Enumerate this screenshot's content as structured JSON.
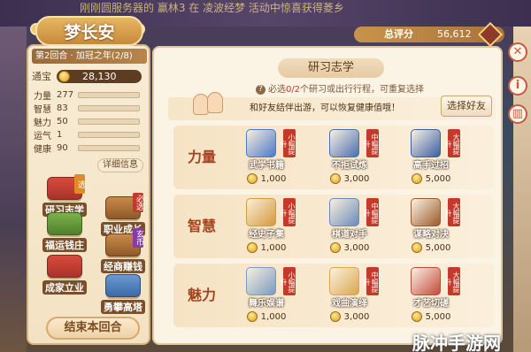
{
  "header": {
    "ticker": "刚刚圆服务器的 赢林3 在 凌波经梦 活动中惊喜获得菱乡",
    "title": "梦长安",
    "score_label": "总评分",
    "score_value": "56,612"
  },
  "left_panel": {
    "round_info": "第2回合 · 加冠之年(2/8)",
    "coins_label": "通宝",
    "coins_value": "28,130",
    "stats": [
      {
        "name": "力量",
        "value": "277",
        "fraction": 0.3
      },
      {
        "name": "智慧",
        "value": "83",
        "fraction": 0.1
      },
      {
        "name": "魅力",
        "value": "50",
        "fraction": 0.06
      },
      {
        "name": "运气",
        "value": "1",
        "fraction": 0.02
      },
      {
        "name": "健康",
        "value": "90",
        "fraction": 0.4
      }
    ],
    "detail_label": "详细信息",
    "locations": [
      {
        "label": "研习志学",
        "tag": "选"
      },
      {
        "label": "职业成长",
        "tag": "必选"
      },
      {
        "label": "福运钱庄",
        "tag": ""
      },
      {
        "label": "经商赚钱",
        "tag": "玄币"
      },
      {
        "label": "成家立业",
        "tag": ""
      },
      {
        "label": "勇攀高塔",
        "tag": ""
      }
    ],
    "end_label": "结束本回合"
  },
  "main": {
    "section_title": "研习志学",
    "hint_prefix": "必选",
    "hint_count": "0/2",
    "hint_rest": "个研习或出行行程，可重复选择",
    "friend_text": "和好友结伴出游，可以恢复健康值哦！",
    "choose_friend_label": "选择好友",
    "rows": [
      {
        "name": "力量",
        "activities": [
          {
            "name": "武学书籍",
            "tag": "小幅提升",
            "cost": "1,000",
            "color": "#4a7ac9"
          },
          {
            "name": "不拒试炼",
            "tag": "中幅提升",
            "cost": "3,000",
            "color": "#4a6fb0"
          },
          {
            "name": "高手过招",
            "tag": "大幅提升",
            "cost": "5,000",
            "color": "#3a5fa0"
          }
        ]
      },
      {
        "name": "智慧",
        "activities": [
          {
            "name": "经史子集",
            "tag": "小幅提升",
            "cost": "1,000",
            "color": "#d39a3a"
          },
          {
            "name": "棋道对手",
            "tag": "中幅提升",
            "cost": "3,000",
            "color": "#6a8ab8"
          },
          {
            "name": "谋略对决",
            "tag": "大幅提升",
            "cost": "5,000",
            "color": "#9a5a2a"
          }
        ]
      },
      {
        "name": "魅力",
        "activities": [
          {
            "name": "舞乐娱谱",
            "tag": "小幅提升",
            "cost": "1,000",
            "color": "#7a9ac2"
          },
          {
            "name": "戏曲演绎",
            "tag": "中幅提升",
            "cost": "3,000",
            "color": "#d9a84a"
          },
          {
            "name": "才艺切磋",
            "tag": "大幅提升",
            "cost": "5,000",
            "color": "#c24a3a"
          }
        ]
      }
    ]
  },
  "side_buttons": [
    {
      "icon": "close-icon",
      "glyph": "✕"
    },
    {
      "icon": "info-icon",
      "glyph": "i"
    },
    {
      "icon": "bar-chart-icon",
      "glyph": "▥"
    }
  ],
  "watermark": "脉冲手游网"
}
